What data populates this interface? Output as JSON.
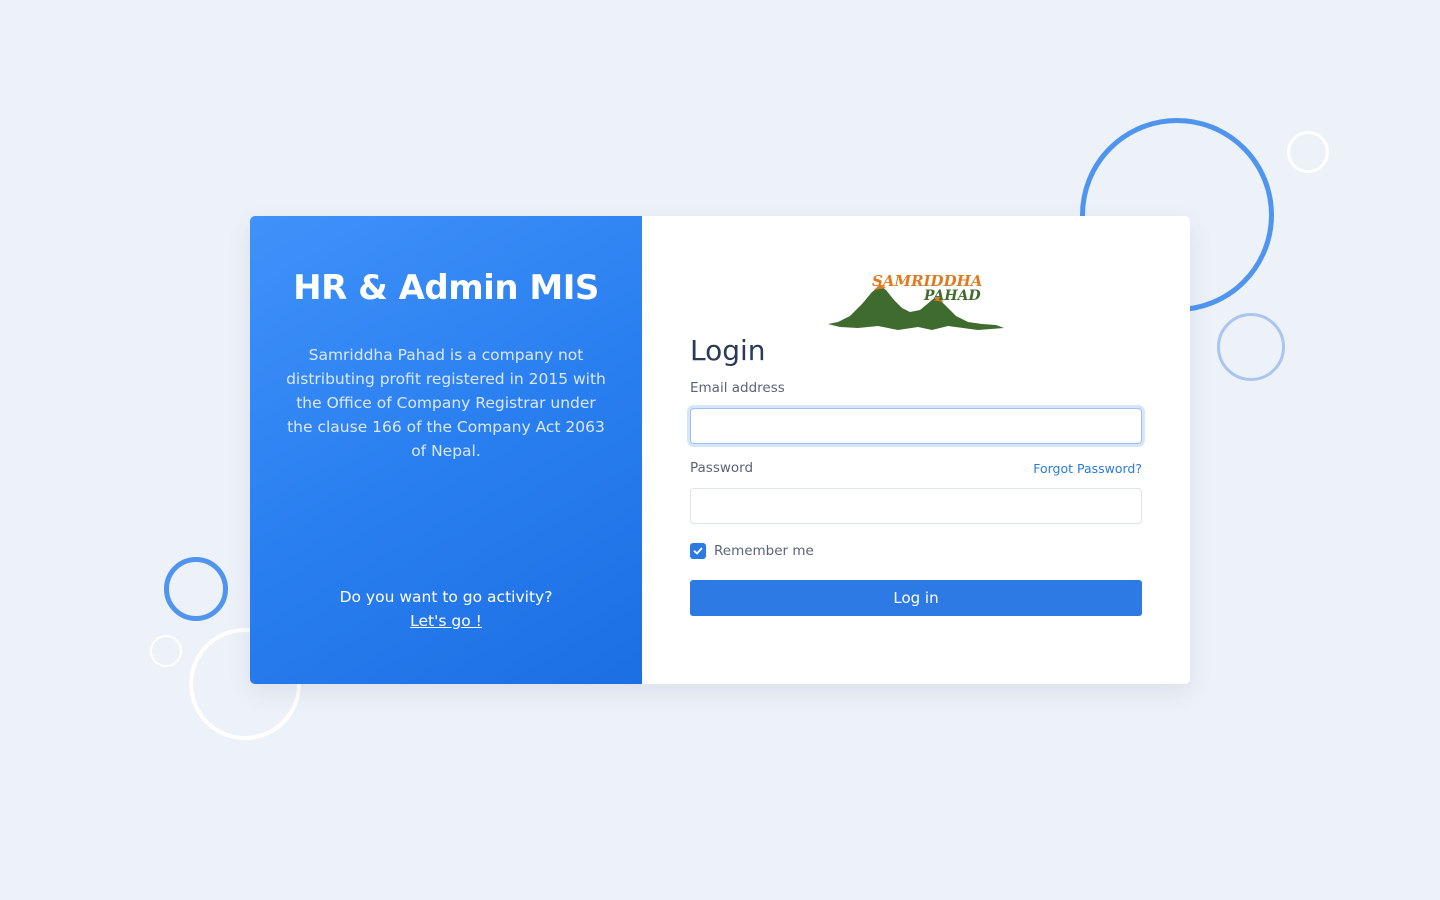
{
  "brand": {
    "title": "HR & Admin MIS",
    "description": "Samriddha Pahad is a company not distributing profit registered in 2015 with the Office of Company Registrar under the clause 166 of the Company Act 2063 of Nepal.",
    "question": "Do you want to go activity?",
    "link_label": "Let's go !"
  },
  "logo": {
    "line1": "SAMRIDDHA",
    "line2": "PAHAD"
  },
  "form": {
    "heading": "Login",
    "email_label": "Email address",
    "email_value": "",
    "password_label": "Password",
    "password_value": "",
    "forgot_label": "Forgot Password?",
    "remember_label": "Remember me",
    "remember_checked": true,
    "submit_label": "Log in"
  },
  "colors": {
    "accent": "#2d7ae4",
    "background": "#edf1f8",
    "panel_gradient_start": "#4092fa",
    "panel_gradient_end": "#1c6fe3",
    "logo_orange": "#e07a20",
    "logo_green": "#3f6b2e"
  }
}
